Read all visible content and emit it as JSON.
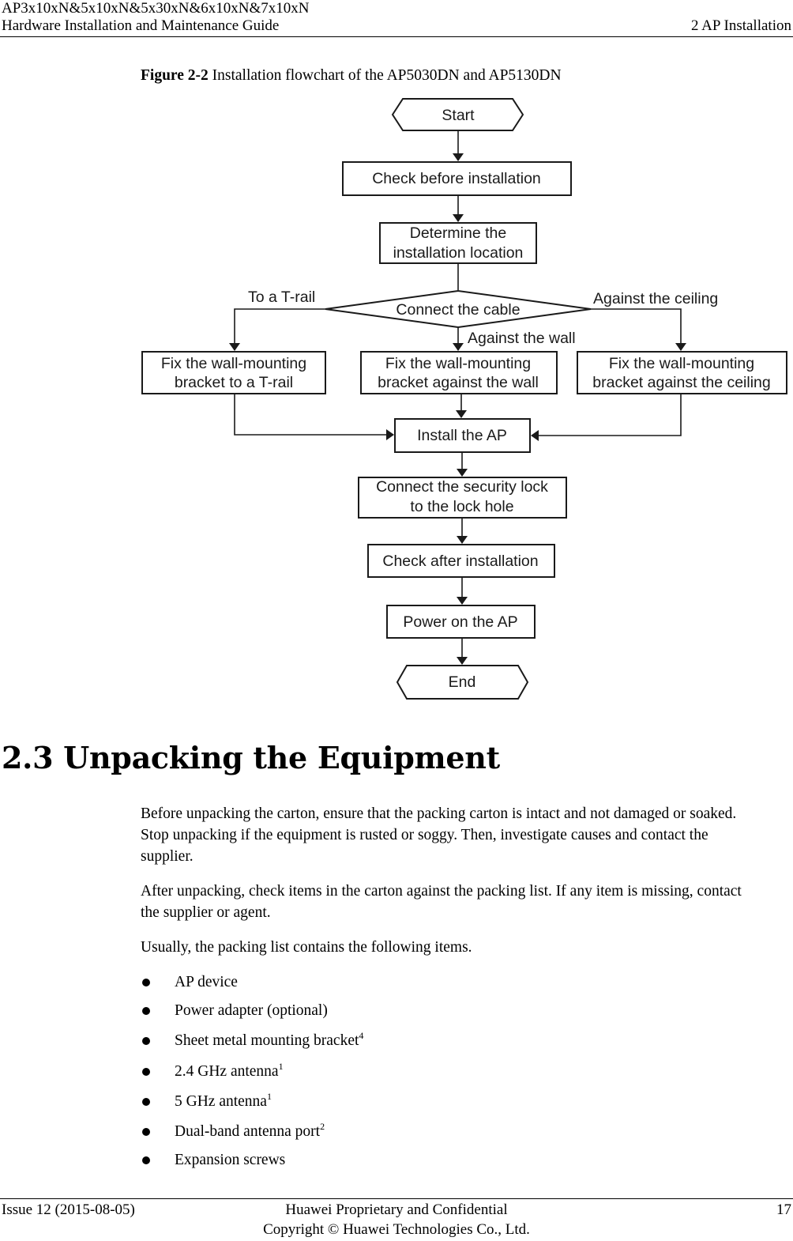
{
  "header": {
    "product_line": "AP3x10xN&5x10xN&5x30xN&6x10xN&7x10xN",
    "guide_title": "Hardware Installation and Maintenance Guide",
    "chapter": "2 AP Installation"
  },
  "figure": {
    "label": "Figure 2-2",
    "caption": " Installation flowchart of the AP5030DN and AP5130DN",
    "nodes": {
      "start": "Start",
      "check_before": "Check before installation",
      "determine_1": "Determine the",
      "determine_2": "installation location",
      "connect_cable": "Connect the cable",
      "trail_1": "Fix the wall-mounting",
      "trail_2": "bracket to a T-rail",
      "wall_1": "Fix the wall-mounting",
      "wall_2": "bracket against the wall",
      "ceiling_1": "Fix the wall-mounting",
      "ceiling_2": "bracket against the ceiling",
      "install_ap": "Install the AP",
      "lock_1": "Connect the security lock",
      "lock_2": "to the lock hole",
      "check_after": "Check after installation",
      "power_on": "Power on the AP",
      "end": "End"
    },
    "branch_labels": {
      "trail": "To  a T-rail",
      "wall": "Against the wall",
      "ceiling": "Against the ceiling"
    }
  },
  "section": {
    "heading": "2.3 Unpacking the Equipment",
    "paragraphs": [
      "Before unpacking the carton, ensure that the packing carton is intact and not damaged or soaked.",
      "Stop unpacking if the equipment is rusted or soggy. Then, investigate causes and contact the",
      "supplier.",
      "After unpacking, check items in the carton against the packing list. If any item is missing, contact",
      "the supplier or agent.",
      "Usually, the packing list contains the following items."
    ],
    "items": [
      {
        "text": "AP device",
        "note": ""
      },
      {
        "text": "Power adapter (optional)",
        "note": ""
      },
      {
        "text": "Sheet metal mounting bracket",
        "note": "4"
      },
      {
        "text": "2.4 GHz antenna",
        "note": "1"
      },
      {
        "text": "5 GHz antenna",
        "note": "1"
      },
      {
        "text": "Dual-band antenna port",
        "note": "2"
      },
      {
        "text": "Expansion screws",
        "note": ""
      }
    ]
  },
  "footer": {
    "issue": "Issue 12 (2015-08-05)",
    "confidential": "Huawei Proprietary and Confidential",
    "copyright": "Copyright © Huawei Technologies Co., Ltd.",
    "page_number": "17"
  }
}
